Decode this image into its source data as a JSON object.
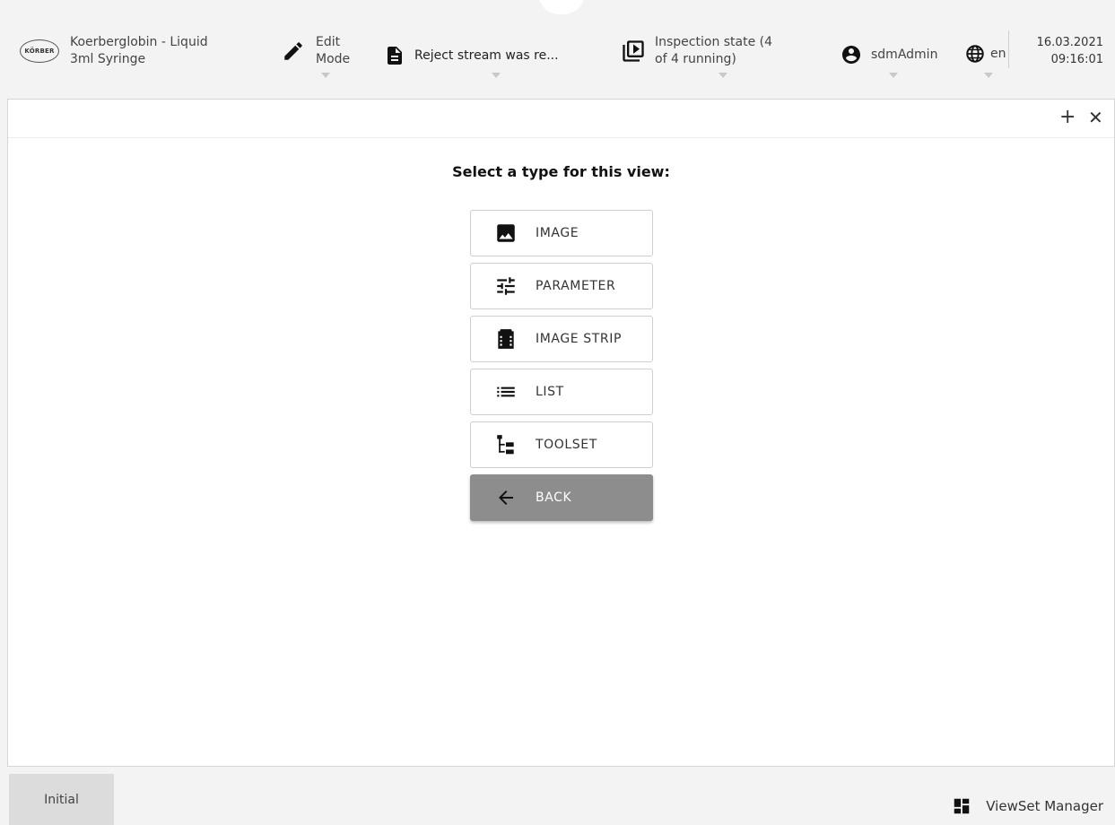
{
  "header": {
    "product_line1": "Koerberglobin - Liquid",
    "product_line2": "3ml Syringe",
    "logo_text": "KÖRBER",
    "edit_line1": "Edit",
    "edit_line2": "Mode",
    "reject_text": "Reject stream was re...",
    "inspection_line1": "Inspection state (4",
    "inspection_line2": "of 4 running)",
    "user": "sdmAdmin",
    "language": "en",
    "date": "16.03.2021",
    "time": "09:16:01"
  },
  "panel": {
    "add_icon": "+",
    "close_icon": "✕",
    "prompt": "Select a type for this view:",
    "options": [
      {
        "label": "IMAGE",
        "icon": "image-icon"
      },
      {
        "label": "PARAMETER",
        "icon": "sliders-icon"
      },
      {
        "label": "IMAGE STRIP",
        "icon": "film-strip-icon"
      },
      {
        "label": "LIST",
        "icon": "list-icon"
      },
      {
        "label": "TOOLSET",
        "icon": "tree-icon"
      }
    ],
    "back_label": "BACK"
  },
  "footer": {
    "tab_label": "Initial",
    "viewset_label": "ViewSet Manager"
  },
  "colors": {
    "background": "#f3f3f3",
    "panel": "#ffffff",
    "back_button": "#8d8d8d",
    "footer_tab": "#dcdcdc"
  }
}
